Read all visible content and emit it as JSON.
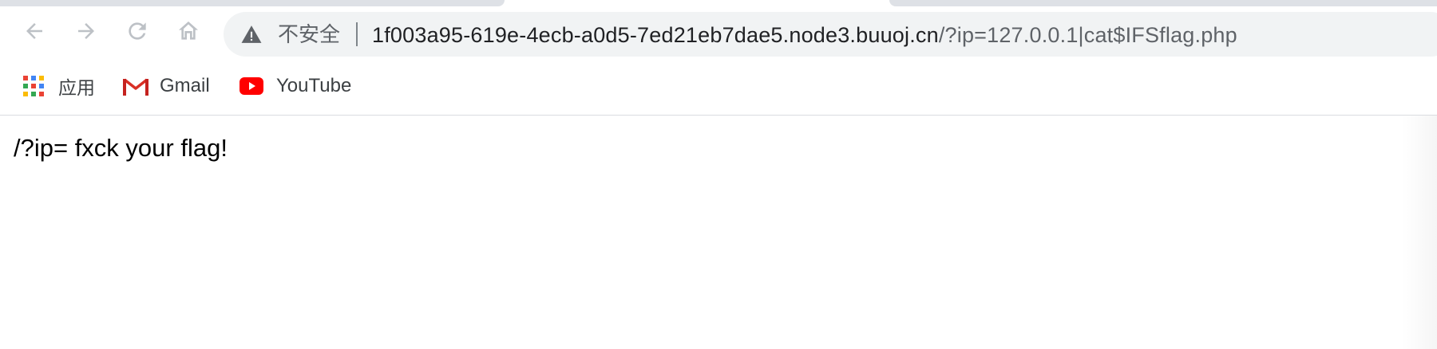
{
  "toolbar": {
    "back_icon": "arrow-left-icon",
    "forward_icon": "arrow-right-icon",
    "reload_icon": "reload-icon",
    "home_icon": "home-icon"
  },
  "omnibox": {
    "security_icon": "warning-triangle-icon",
    "security_label": "不安全",
    "url_host": "1f003a95-619e-4ecb-a0d5-7ed21eb7dae5.node3.buuoj.cn",
    "url_path": "/?ip=127.0.0.1|cat$IFSflag.php"
  },
  "bookmarks": {
    "items": [
      {
        "label": "应用",
        "icon": "apps-grid-icon"
      },
      {
        "label": "Gmail",
        "icon": "gmail-icon"
      },
      {
        "label": "YouTube",
        "icon": "youtube-icon"
      }
    ]
  },
  "page": {
    "text": "/?ip= fxck your flag!"
  },
  "colors": {
    "toolbar_icon": "#bdc1c6",
    "omnibox_bg": "#f1f3f4",
    "url_host": "#202124",
    "url_path": "#5f6368",
    "youtube_red": "#ff0000",
    "gmail_red": "#d93025"
  }
}
